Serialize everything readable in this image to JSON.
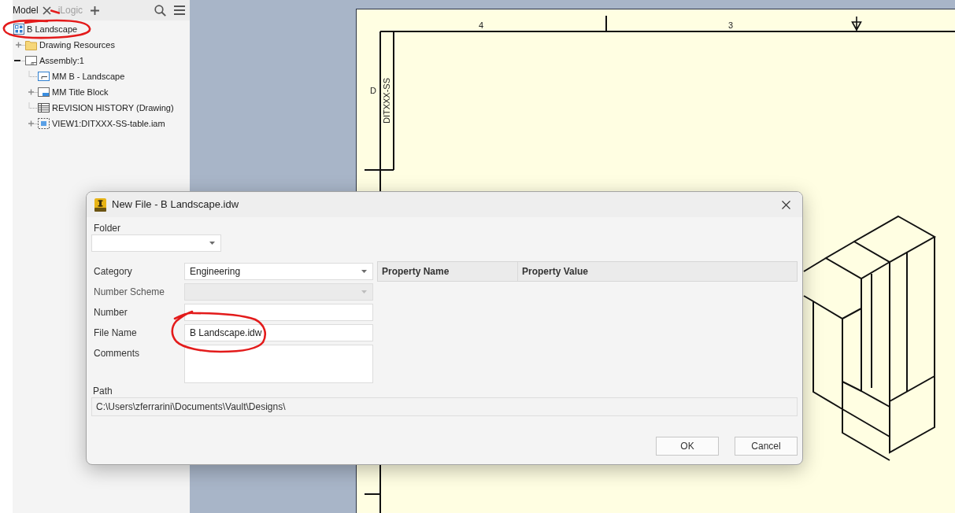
{
  "browser": {
    "tabs": [
      {
        "label": "Model",
        "selected": true
      },
      {
        "label": "iLogic",
        "selected": false
      }
    ],
    "tree": {
      "label": "B Landscape",
      "kind": "drawing",
      "children": [
        {
          "label": "Drawing Resources",
          "kind": "folder",
          "expanded": false
        },
        {
          "label": "Assembly:1",
          "kind": "sheet",
          "expanded": true,
          "children": [
            {
              "label": "MM B - Landscape",
              "kind": "border"
            },
            {
              "label": "MM Title Block",
              "kind": "title-block",
              "expanded": false
            },
            {
              "label": "REVISION HISTORY (Drawing)",
              "kind": "table"
            },
            {
              "label": "VIEW1:DITXXX-SS-table.iam",
              "kind": "view",
              "expanded": false
            }
          ]
        }
      ]
    }
  },
  "sheet": {
    "zone_numbers": [
      "4",
      "3"
    ],
    "zone_letters": [
      "D"
    ],
    "title_strip_text": "DITXXX-SS"
  },
  "dialog": {
    "title": "New File - B Landscape.idw",
    "folder": {
      "label": "Folder",
      "kind": "dropdown"
    },
    "fields": [
      {
        "label": "Category",
        "kind": "dropdown",
        "value": "Engineering",
        "disabled": false
      },
      {
        "label": "Number Scheme",
        "kind": "dropdown",
        "disabled": true
      },
      {
        "label": "Number",
        "kind": "text",
        "disabled": false
      },
      {
        "label": "File Name",
        "kind": "text",
        "value": "B Landscape.idw",
        "disabled": false
      },
      {
        "label": "Comments",
        "kind": "textarea",
        "disabled": false
      }
    ],
    "property_table": {
      "columns": [
        "Property Name",
        "Property Value"
      ]
    },
    "path": {
      "label": "Path",
      "value": "C:\\Users\\zferrarini\\Documents\\Vault\\Designs\\"
    },
    "buttons": [
      {
        "label": "OK"
      },
      {
        "label": "Cancel"
      }
    ]
  }
}
